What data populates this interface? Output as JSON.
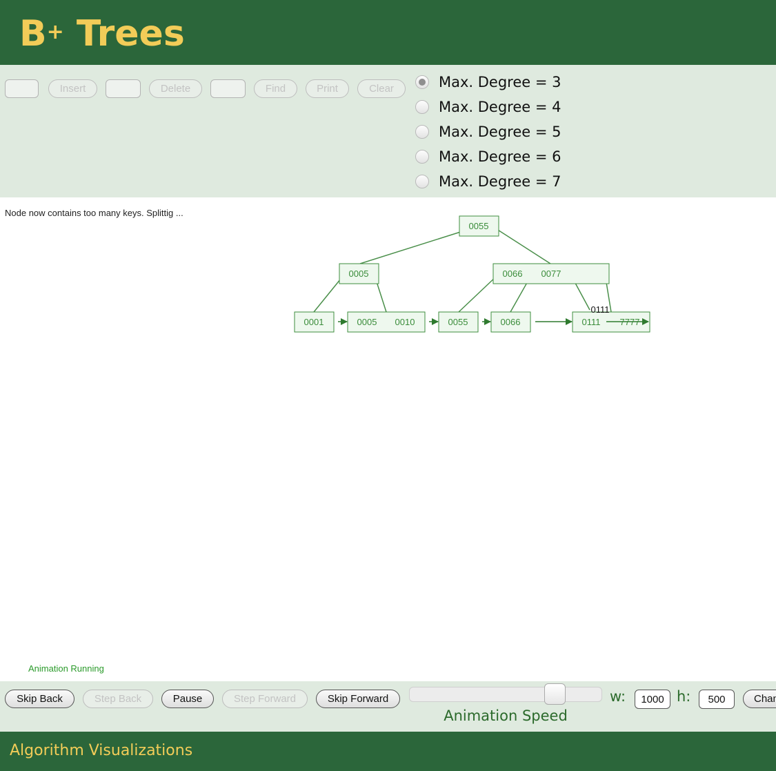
{
  "header": {
    "title": "B",
    "title_sup": "+",
    "title_rest": " Trees"
  },
  "toolbar": {
    "insert_value": "",
    "insert_label": "Insert",
    "delete_value": "",
    "delete_label": "Delete",
    "find_value": "",
    "find_label": "Find",
    "print_label": "Print",
    "clear_label": "Clear"
  },
  "degree_options": [
    {
      "label": "Max. Degree = 3",
      "checked": true
    },
    {
      "label": "Max. Degree = 4",
      "checked": false
    },
    {
      "label": "Max. Degree = 5",
      "checked": false
    },
    {
      "label": "Max. Degree = 6",
      "checked": false
    },
    {
      "label": "Max. Degree = 7",
      "checked": false
    }
  ],
  "canvas": {
    "message": "Node now contains too many keys.  Splittig ...",
    "tree": {
      "root": [
        "0055"
      ],
      "internal": [
        [
          "0005"
        ],
        [
          "0066",
          "0077"
        ]
      ],
      "leaves": [
        [
          "0001"
        ],
        [
          "0005",
          "0010"
        ],
        [
          "0055"
        ],
        [
          "0066"
        ],
        [
          "0111",
          "7777"
        ]
      ],
      "floating_key": "0111"
    },
    "status": "Animation Running"
  },
  "playback": {
    "skip_back": "Skip Back",
    "step_back": "Step Back",
    "pause": "Pause",
    "step_forward": "Step Forward",
    "skip_forward": "Skip Forward",
    "speed_label": "Animation Speed",
    "w_label": "w:",
    "w_value": "1000",
    "h_label": "h:",
    "h_value": "500",
    "change_label": "Change Canvas Size"
  },
  "footer": {
    "text": "Algorithm Visualizations"
  },
  "colors": {
    "header_bg": "#2b663a",
    "title": "#f2cc58",
    "panel_bg": "#dfeadf",
    "tree_stroke": "#3e8e3e",
    "tree_fill": "#eef8ee"
  }
}
